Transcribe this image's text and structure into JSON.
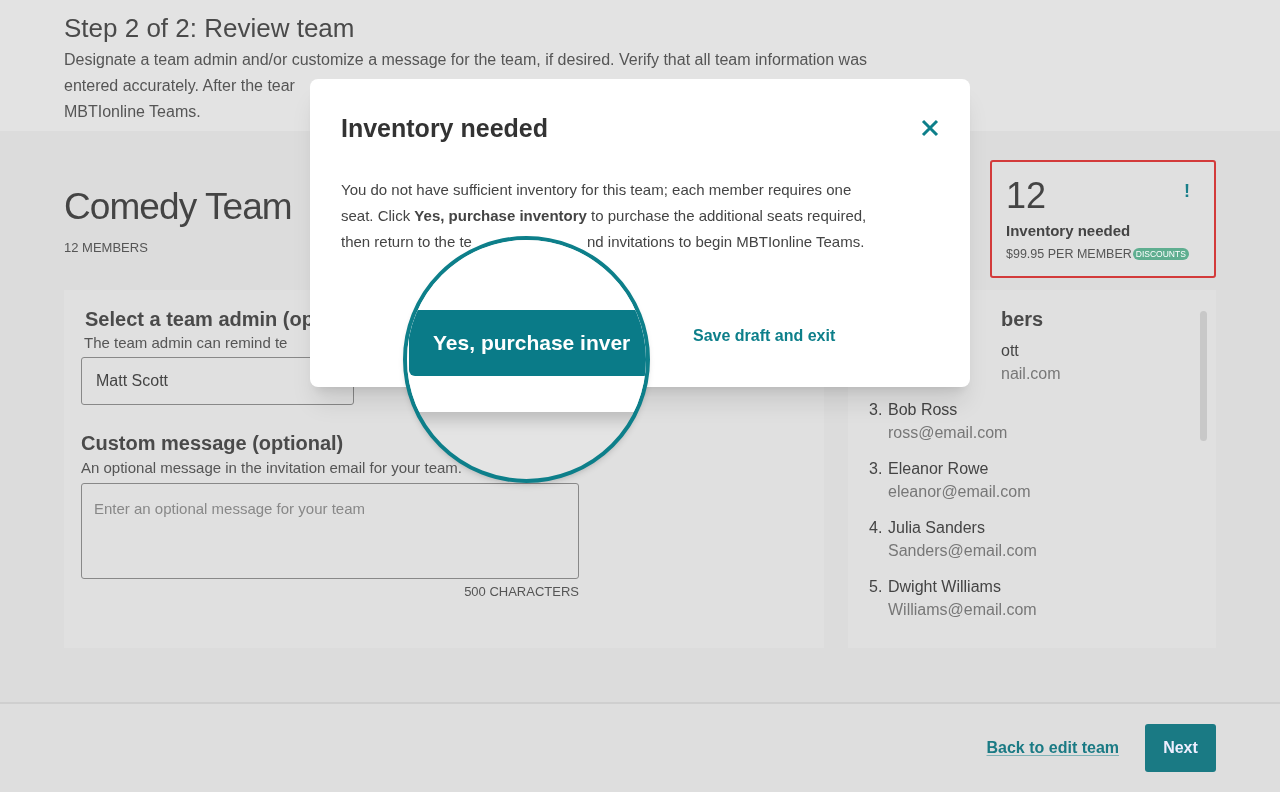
{
  "header": {
    "title": "Step 2 of 2: Review team",
    "description_lines": [
      "Designate a team admin and/or customize a message for the team, if desired. Verify that all team information was",
      "entered accurately. After the tear",
      "MBTIonline Teams."
    ]
  },
  "team": {
    "name": "Comedy Team",
    "members_label": "12 MEMBERS"
  },
  "inventory_card": {
    "count": "12",
    "alert": "!",
    "title": "Inventory needed",
    "price": "$99.95 PER MEMBER",
    "badge": "DISCOUNTS"
  },
  "admin_section": {
    "title": "Select a team admin (op",
    "description": "The team admin can remind te",
    "select_value": "Matt Scott"
  },
  "message_section": {
    "title": "Custom message (optional)",
    "description": "An optional message in the invitation email for your team.",
    "placeholder": "Enter an optional message for your team",
    "counter": "500 CHARACTERS"
  },
  "members_panel": {
    "title": "bers",
    "partial_member": {
      "name": "ott",
      "email": "nail.com"
    },
    "members": [
      {
        "number": "3.",
        "name": "Bob Ross",
        "email": "ross@email.com"
      },
      {
        "number": "3.",
        "name": "Eleanor Rowe",
        "email": "eleanor@email.com"
      },
      {
        "number": "4.",
        "name": "Julia Sanders",
        "email": "Sanders@email.com"
      },
      {
        "number": "5.",
        "name": "Dwight Williams",
        "email": "Williams@email.com"
      }
    ]
  },
  "footer": {
    "back_link": "Back to edit team",
    "next_button": "Next"
  },
  "modal": {
    "title": "Inventory needed",
    "body_lines": [
      "You do not have sufficient inventory for this team; each member requires one",
      "seat. Click **Yes, purchase inventory** to purchase the additional seats required,"
    ],
    "body_fragments": [
      "then return to the te",
      "nd invitations to begin MBTIonline Teams."
    ],
    "secondary_link": "Save draft and exit",
    "magnified_button": "Yes, purchase inver"
  }
}
